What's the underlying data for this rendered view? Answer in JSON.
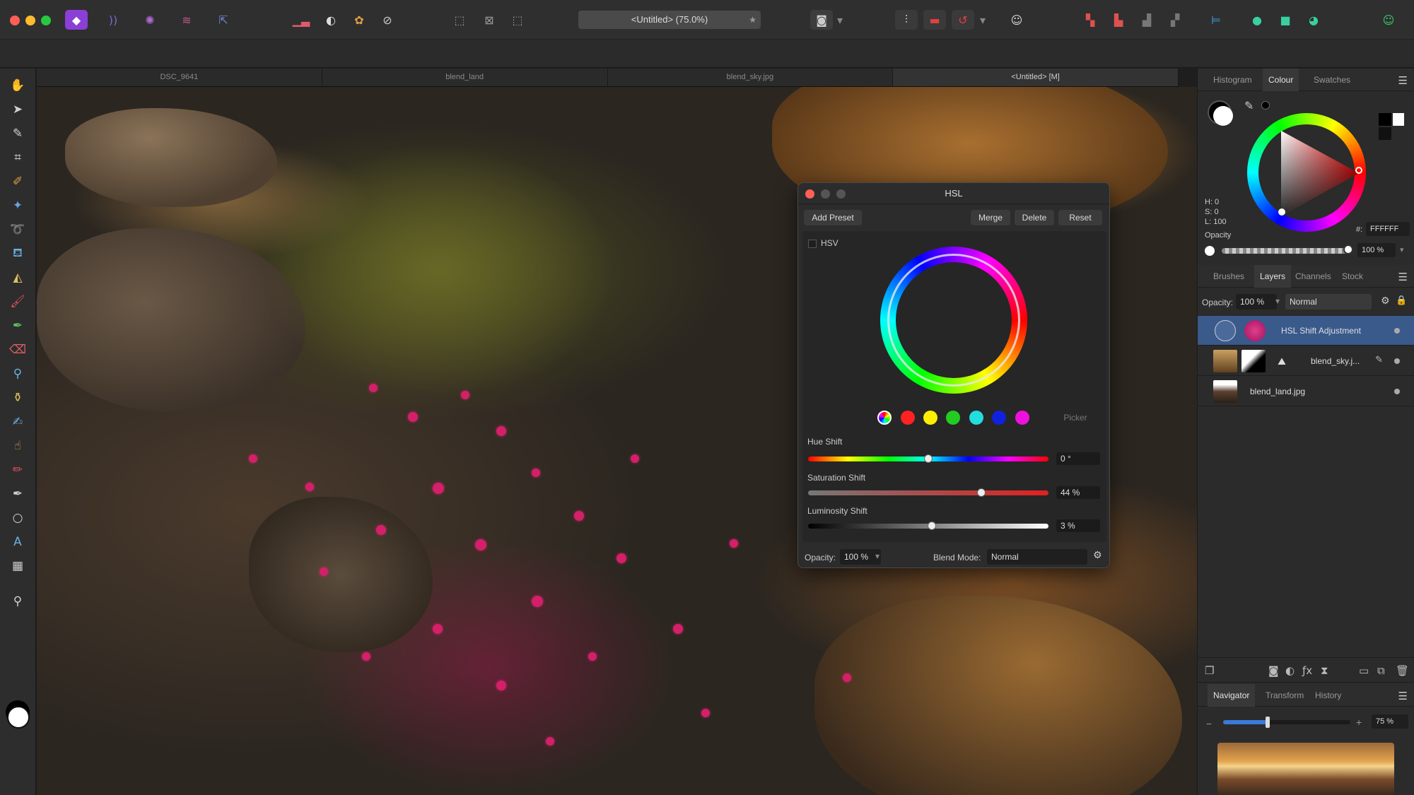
{
  "window": {
    "title": "<Untitled> (75.0%)"
  },
  "doc_tabs": [
    "DSC_9641",
    "blend_land",
    "blend_sky.jpg",
    "<Untitled> [M]"
  ],
  "hsl_dialog": {
    "title": "HSL",
    "add_preset": "Add Preset",
    "merge": "Merge",
    "delete": "Delete",
    "reset": "Reset",
    "hsv_label": "HSV",
    "picker": "Picker",
    "hue_label": "Hue Shift",
    "hue_value": "0 °",
    "hue_fraction": 0.5,
    "sat_label": "Saturation Shift",
    "sat_value": "44 %",
    "sat_fraction": 0.72,
    "lum_label": "Luminosity Shift",
    "lum_value": "3 %",
    "lum_fraction": 0.515,
    "opacity_label": "Opacity:",
    "opacity_value": "100 %",
    "blend_label": "Blend Mode:",
    "blend_value": "Normal",
    "swatch_colors": [
      "#ff2222",
      "#ffee00",
      "#22cc22",
      "#22dddd",
      "#1122dd",
      "#ee11dd"
    ]
  },
  "colour_panel": {
    "tabs": [
      "Histogram",
      "Colour",
      "Swatches"
    ],
    "active_tab": "Colour",
    "h": "H: 0",
    "s": "S: 0",
    "l": "L: 100",
    "hex_label": "#:",
    "hex_value": "FFFFFF",
    "opacity_label": "Opacity",
    "opacity_value": "100 %"
  },
  "layers_panel": {
    "tabs": [
      "Brushes",
      "Layers",
      "Channels",
      "Stock"
    ],
    "active_tab": "Layers",
    "opacity_label": "Opacity:",
    "opacity_value": "100 %",
    "blend_mode": "Normal",
    "layers": [
      {
        "name": "HSL Shift Adjustment",
        "selected": true
      },
      {
        "name": "blend_sky.j...",
        "selected": false
      },
      {
        "name": "blend_land.jpg",
        "selected": false
      }
    ]
  },
  "navigator_panel": {
    "tabs": [
      "Navigator",
      "Transform",
      "History"
    ],
    "active_tab": "Navigator",
    "zoom_value": "75 %",
    "zoom_fraction": 0.35
  }
}
